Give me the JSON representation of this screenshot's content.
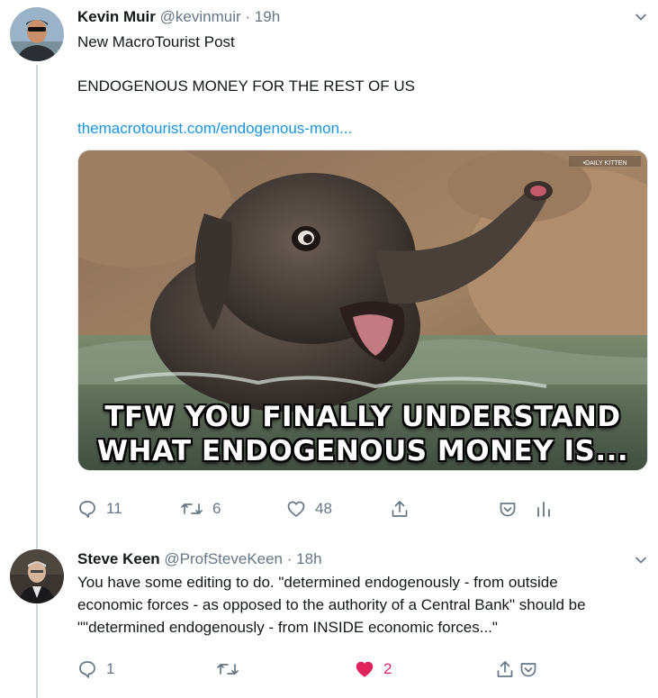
{
  "tweet1": {
    "name": "Kevin Muir",
    "handle": "@kevinmuir",
    "separator": "·",
    "time": "19h",
    "line1": "New MacroTourist Post",
    "line2": "ENDOGENOUS MONEY FOR THE REST OF US",
    "link": "themacrotourist.com/endogenous-mon...",
    "media": {
      "caption_line1": "TFW YOU FINALLY UNDERSTAND",
      "caption_line2": "WHAT ENDOGENOUS MONEY IS..."
    },
    "actions": {
      "reply_count": "11",
      "retweet_count": "6",
      "like_count": "48"
    }
  },
  "tweet2": {
    "name": "Steve Keen",
    "handle": "@ProfSteveKeen",
    "separator": "·",
    "time": "18h",
    "lines": [
      "You have some editing to do. \"determined endogenously - from outside",
      "economic forces - as opposed to the authority of a Central Bank\" should be",
      "\"\"determined endogenously - from INSIDE economic forces...\""
    ],
    "actions": {
      "reply_count": "1",
      "retweet_count": "",
      "like_count": "2"
    }
  },
  "colors": {
    "text": "#14171a",
    "secondary": "#657786",
    "link": "#1b95e0",
    "like": "#e0245e",
    "thread_line": "#ccd6dd"
  }
}
